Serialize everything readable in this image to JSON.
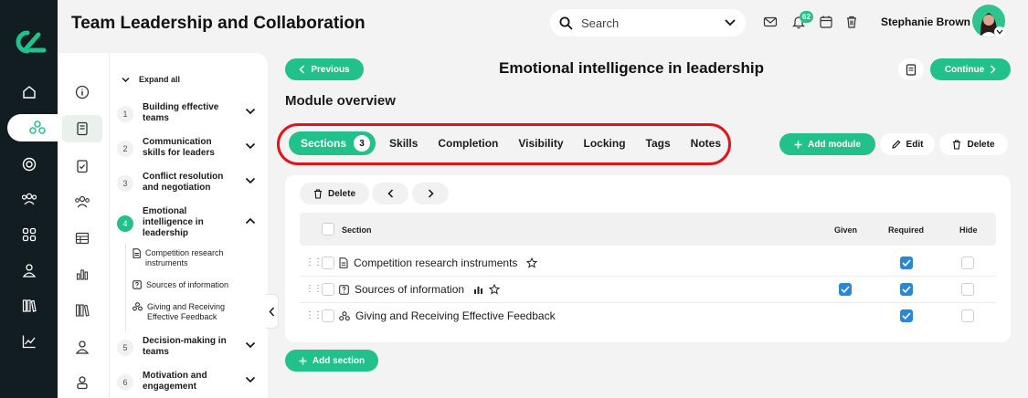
{
  "app": {
    "title": "Team Leadership and Collaboration"
  },
  "header": {
    "search_label": "Search",
    "notification_count": "62",
    "user_name": "Stephanie Brown"
  },
  "colors": {
    "accent": "#22c08a",
    "rail": "#121d22",
    "highlight_ring": "#e0151b",
    "checkbox": "#2b86d6"
  },
  "rail": {
    "icons": [
      "home-icon",
      "modules-icon",
      "target-icon",
      "users-icon",
      "apps-icon",
      "user-icon",
      "library-icon",
      "chart-icon"
    ]
  },
  "sidebar": {
    "icons": [
      "info-icon",
      "book-icon",
      "checklist-icon",
      "team-icon",
      "table-icon",
      "bar-chart-icon",
      "books-icon",
      "person-icon",
      "person-badge-icon"
    ],
    "expand_all": "Expand all",
    "modules": [
      {
        "num": "1",
        "title": "Building effective teams"
      },
      {
        "num": "2",
        "title": "Communication skills for leaders"
      },
      {
        "num": "3",
        "title": "Conflict resolution and negotiation"
      },
      {
        "num": "4",
        "title": "Emotional intelligence in leadership"
      },
      {
        "num": "5",
        "title": "Decision-making in teams"
      },
      {
        "num": "6",
        "title": "Motivation and engagement"
      }
    ],
    "subsections": [
      {
        "icon": "document-icon",
        "title": "Competition research instruments"
      },
      {
        "icon": "question-icon",
        "title": "Sources of information"
      },
      {
        "icon": "group-icon",
        "title": "Giving and Receiving Effective Feedback"
      }
    ]
  },
  "main": {
    "previous_label": "Previous",
    "continue_label": "Continue",
    "module_title": "Emotional intelligence in leadership",
    "overview_title": "Module overview",
    "tabs": [
      {
        "label": "Sections",
        "count": "3"
      },
      {
        "label": "Skills"
      },
      {
        "label": "Completion"
      },
      {
        "label": "Visibility"
      },
      {
        "label": "Locking"
      },
      {
        "label": "Tags"
      },
      {
        "label": "Notes"
      }
    ],
    "add_module_label": "Add module",
    "edit_label": "Edit",
    "delete_label": "Delete",
    "table": {
      "delete_label": "Delete",
      "columns": {
        "section": "Section",
        "given": "Given",
        "required": "Required",
        "hide": "Hide"
      },
      "rows": [
        {
          "name": "Competition research instruments",
          "icon": "document-icon",
          "given": false,
          "required": true,
          "hide": false
        },
        {
          "name": "Sources of information",
          "icon": "question-icon",
          "given": true,
          "required": true,
          "hide": false
        },
        {
          "name": "Giving and Receiving Effective Feedback",
          "icon": "group-icon",
          "given": false,
          "required": true,
          "hide": false
        }
      ]
    },
    "add_section_label": "Add section"
  }
}
